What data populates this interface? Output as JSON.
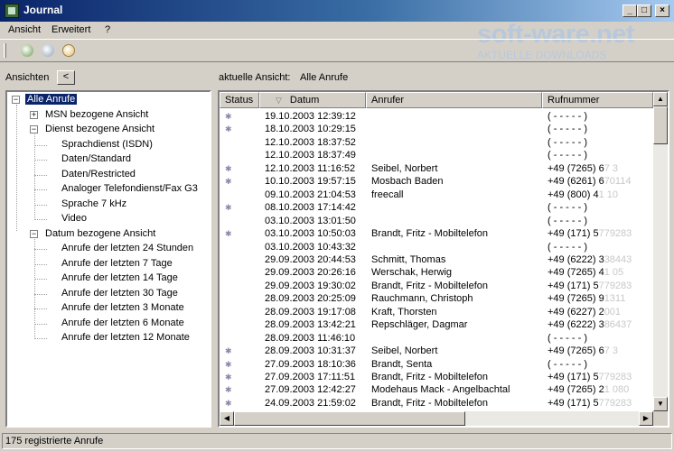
{
  "window": {
    "title": "Journal",
    "min": "_",
    "max": "□",
    "close": "×"
  },
  "menu": [
    "Ansicht",
    "Erweitert",
    "?"
  ],
  "watermark": {
    "main": "soft-ware.net",
    "sub": "AKTUELLE DOWNLOADS"
  },
  "toolbar": {
    "icons": [
      "refresh-icon",
      "delete-icon",
      "search-icon"
    ]
  },
  "left_panel": {
    "label": "Ansichten",
    "collapse_label": "<",
    "tree": [
      {
        "label": "Alle Anrufe",
        "level": 0,
        "toggle": "−",
        "selected": true
      },
      {
        "label": "MSN bezogene Ansicht",
        "level": 1,
        "toggle": "+"
      },
      {
        "label": "Dienst bezogene Ansicht",
        "level": 1,
        "toggle": "−"
      },
      {
        "label": "Sprachdienst (ISDN)",
        "level": 2
      },
      {
        "label": "Daten/Standard",
        "level": 2
      },
      {
        "label": "Daten/Restricted",
        "level": 2
      },
      {
        "label": "Analoger Telefondienst/Fax G3",
        "level": 2
      },
      {
        "label": "Sprache 7 kHz",
        "level": 2
      },
      {
        "label": "Video",
        "level": 2
      },
      {
        "label": "Datum bezogene Ansicht",
        "level": 1,
        "toggle": "−"
      },
      {
        "label": "Anrufe der letzten 24 Stunden",
        "level": 2
      },
      {
        "label": "Anrufe der letzten 7 Tage",
        "level": 2
      },
      {
        "label": "Anrufe der letzten 14 Tage",
        "level": 2
      },
      {
        "label": "Anrufe der letzten 30 Tage",
        "level": 2
      },
      {
        "label": "Anrufe der letzten 3 Monate",
        "level": 2
      },
      {
        "label": "Anrufe der letzten 6 Monate",
        "level": 2
      },
      {
        "label": "Anrufe der letzten 12 Monate",
        "level": 2
      }
    ]
  },
  "right_panel": {
    "label": "aktuelle Ansicht:",
    "value": "Alle Anrufe",
    "columns": [
      "Status",
      "Datum",
      "Anrufer",
      "Rufnummer"
    ],
    "sort_indicator": "▽",
    "rows": [
      {
        "status": "✱",
        "date": "19.10.2003 12:39:12",
        "caller": "",
        "number": "( - - - - - )",
        "masked": ""
      },
      {
        "status": "✱",
        "date": "18.10.2003 10:29:15",
        "caller": "",
        "number": "( - - - - - )",
        "masked": ""
      },
      {
        "status": "",
        "date": "12.10.2003 18:37:52",
        "caller": "",
        "number": "( - - - - - )",
        "masked": ""
      },
      {
        "status": "",
        "date": "12.10.2003 18:37:49",
        "caller": "",
        "number": "( - - - - - )",
        "masked": ""
      },
      {
        "status": "✱",
        "date": "12.10.2003 11:16:52",
        "caller": "Seibel, Norbert",
        "number": "+49 (7265) 6",
        "masked": "7 3"
      },
      {
        "status": "✱",
        "date": "10.10.2003 19:57:15",
        "caller": "Mosbach Baden",
        "number": "+49 (6261) 6",
        "masked": "70114"
      },
      {
        "status": "",
        "date": "09.10.2003 21:04:53",
        "caller": "freecall",
        "number": "+49 (800) 4",
        "masked": "1 10"
      },
      {
        "status": "✱",
        "date": "08.10.2003 17:14:42",
        "caller": "",
        "number": "( - - - - - )",
        "masked": ""
      },
      {
        "status": "",
        "date": "03.10.2003 13:01:50",
        "caller": "",
        "number": "( - - - - - )",
        "masked": ""
      },
      {
        "status": "✱",
        "date": "03.10.2003 10:50:03",
        "caller": "Brandt, Fritz - Mobiltelefon",
        "number": "+49 (171) 5",
        "masked": "779283"
      },
      {
        "status": "",
        "date": "03.10.2003 10:43:32",
        "caller": "",
        "number": "( - - - - - )",
        "masked": ""
      },
      {
        "status": "",
        "date": "29.09.2003 20:44:53",
        "caller": "Schmitt, Thomas",
        "number": "+49 (6222) 3",
        "masked": "38443"
      },
      {
        "status": "",
        "date": "29.09.2003 20:26:16",
        "caller": "Werschak, Herwig",
        "number": "+49 (7265) 4",
        "masked": "1 05"
      },
      {
        "status": "",
        "date": "29.09.2003 19:30:02",
        "caller": "Brandt, Fritz - Mobiltelefon",
        "number": "+49 (171) 5",
        "masked": "779283"
      },
      {
        "status": "",
        "date": "28.09.2003 20:25:09",
        "caller": "Rauchmann, Christoph",
        "number": "+49 (7265) 9",
        "masked": "1311"
      },
      {
        "status": "",
        "date": "28.09.2003 19:17:08",
        "caller": "Kraft, Thorsten",
        "number": "+49 (6227) 2",
        "masked": "001"
      },
      {
        "status": "",
        "date": "28.09.2003 13:42:21",
        "caller": "Repschläger, Dagmar",
        "number": "+49 (6222) 3",
        "masked": "86437"
      },
      {
        "status": "",
        "date": "28.09.2003 11:46:10",
        "caller": "",
        "number": "( - - - - - )",
        "masked": ""
      },
      {
        "status": "✱",
        "date": "28.09.2003 10:31:37",
        "caller": "Seibel, Norbert",
        "number": "+49 (7265) 6",
        "masked": "7 3"
      },
      {
        "status": "✱",
        "date": "27.09.2003 18:10:36",
        "caller": "Brandt, Senta",
        "number": "( - - - - - )",
        "masked": ""
      },
      {
        "status": "✱",
        "date": "27.09.2003 17:11:51",
        "caller": "Brandt, Fritz - Mobiltelefon",
        "number": "+49 (171) 5",
        "masked": "779283"
      },
      {
        "status": "✱",
        "date": "27.09.2003 12:42:27",
        "caller": "Modehaus Mack - Angelbachtal",
        "number": "+49 (7265) 2",
        "masked": "1 080"
      },
      {
        "status": "✱",
        "date": "24.09.2003 21:59:02",
        "caller": "Brandt, Fritz - Mobiltelefon",
        "number": "+49 (171) 5",
        "masked": "779283"
      }
    ]
  },
  "status_bar": {
    "text": "175 registrierte Anrufe"
  }
}
